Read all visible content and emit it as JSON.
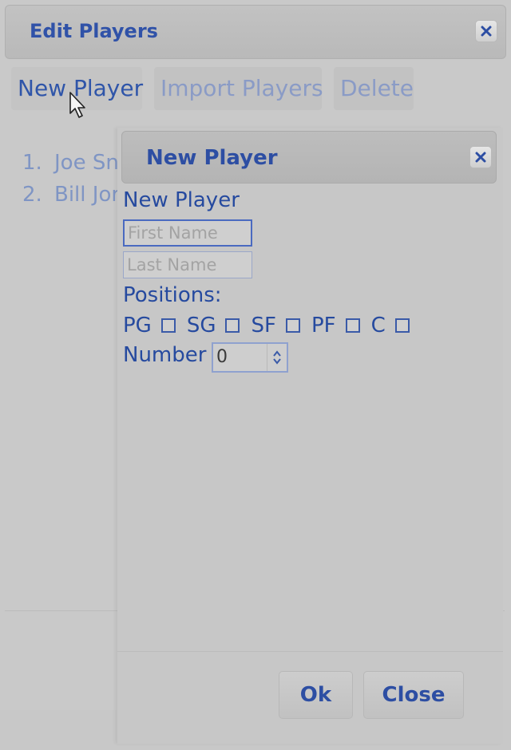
{
  "outer_dialog": {
    "title": "Edit Players",
    "close_icon": "close-icon",
    "toolbar": {
      "new_player": "New Player",
      "import_players": "Import Players",
      "delete": "Delete"
    },
    "players": [
      {
        "number": "1.",
        "name": "Joe Sn"
      },
      {
        "number": "2.",
        "name": "Bill Jor"
      }
    ]
  },
  "inner_dialog": {
    "title": "New Player",
    "close_icon": "close-icon",
    "heading": "New Player",
    "first_name": {
      "value": "",
      "placeholder": "First Name"
    },
    "last_name": {
      "value": "",
      "placeholder": "Last Name"
    },
    "positions_label": "Positions:",
    "positions": [
      {
        "label": "PG",
        "checked": false
      },
      {
        "label": "SG",
        "checked": false
      },
      {
        "label": "SF",
        "checked": false
      },
      {
        "label": "PF",
        "checked": false
      },
      {
        "label": "C",
        "checked": false
      }
    ],
    "number_label": "Number",
    "number_value": "0",
    "ok_label": "Ok",
    "close_label": "Close"
  },
  "colors": {
    "accent": "#2d4ea3",
    "disabled_text": "#8a9bc6",
    "dialog_bg": "#c8c8c8"
  }
}
